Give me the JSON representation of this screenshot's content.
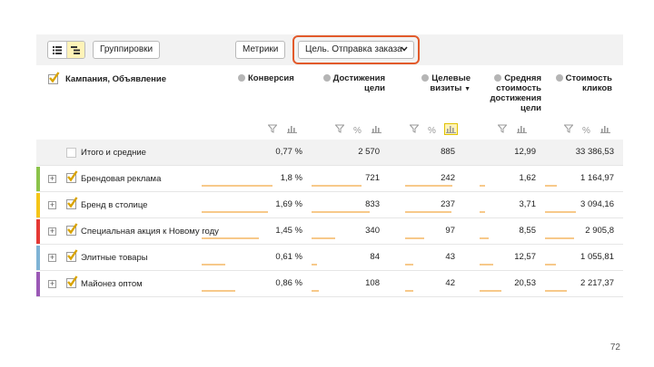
{
  "toolbar": {
    "view_modes": [
      {
        "name": "list-view-icon",
        "active": false
      },
      {
        "name": "tree-view-icon",
        "active": true
      }
    ],
    "groupings_label": "Группировки",
    "metrics_label": "Метрики",
    "goal_select_label": "Цель. Отправка заказа"
  },
  "header": {
    "campaign_label": "Кампания, Объявление",
    "columns": [
      {
        "key": "conversion",
        "label": "Конверсия"
      },
      {
        "key": "goal_reaches",
        "label": "Достижения цели"
      },
      {
        "key": "target_visits",
        "label": "Целевые визиты",
        "sorted": "desc",
        "sort_marker": "▼"
      },
      {
        "key": "avg_goal_cost",
        "label": "Средняя стоимость достижения цели"
      },
      {
        "key": "click_cost",
        "label": "Стоимость кликов"
      }
    ]
  },
  "column_tools": [
    {
      "filter": true,
      "percent": false,
      "chart": true,
      "chart_active": false
    },
    {
      "filter": true,
      "percent": true,
      "chart": true,
      "chart_active": false
    },
    {
      "filter": true,
      "percent": true,
      "chart": true,
      "chart_active": true
    },
    {
      "filter": true,
      "percent": false,
      "chart": true,
      "chart_active": false
    },
    {
      "filter": true,
      "percent": true,
      "chart": true,
      "chart_active": false
    }
  ],
  "total": {
    "name": "Итого и средние",
    "conversion": "0,77 %",
    "goal_reaches": "2 570",
    "target_visits": "885",
    "avg_goal_cost": "12,99",
    "click_cost": "33 386,53"
  },
  "rows": [
    {
      "name": "Брендовая реклама",
      "stripe_color": "#8bc34a",
      "checked": true,
      "conversion": "1,8 %",
      "goal_reaches": "721",
      "target_visits": "242",
      "avg_goal_cost": "1,62",
      "click_cost": "1 164,97"
    },
    {
      "name": "Бренд в столице",
      "stripe_color": "#f5c518",
      "checked": true,
      "conversion": "1,69 %",
      "goal_reaches": "833",
      "target_visits": "237",
      "avg_goal_cost": "3,71",
      "click_cost": "3 094,16"
    },
    {
      "name": "Специальная акция к Новому году",
      "stripe_color": "#e53935",
      "checked": true,
      "conversion": "1,45 %",
      "goal_reaches": "340",
      "target_visits": "97",
      "avg_goal_cost": "8,55",
      "click_cost": "2 905,8"
    },
    {
      "name": "Элитные товары",
      "stripe_color": "#7fb3d5",
      "checked": true,
      "conversion": "0,61 %",
      "goal_reaches": "84",
      "target_visits": "43",
      "avg_goal_cost": "12,57",
      "click_cost": "1 055,81"
    },
    {
      "name": "Майонез оптом",
      "stripe_color": "#9b59b6",
      "checked": true,
      "conversion": "0,86 %",
      "goal_reaches": "108",
      "target_visits": "42",
      "avg_goal_cost": "20,53",
      "click_cost": "2 217,37"
    }
  ],
  "colors": {
    "accent_outline": "#e25a2b",
    "bar": "#f7c98a",
    "checkmark": "#d9a300"
  },
  "page_number": "72"
}
